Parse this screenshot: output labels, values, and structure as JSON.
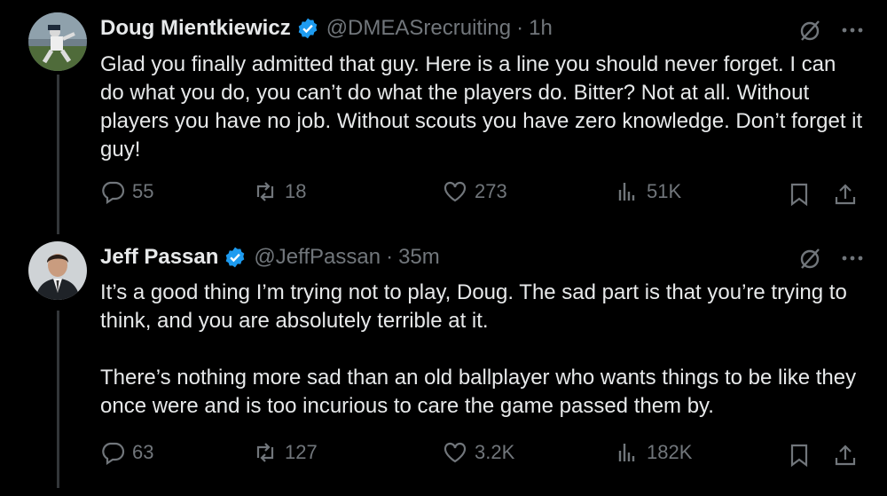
{
  "tweets": [
    {
      "name": "Doug Mientkiewicz",
      "handle": "@DMEASrecruiting",
      "dot": "·",
      "time": "1h",
      "paragraphs": [
        "Glad you finally admitted that guy.  Here is a line you should never forget.  I can do what you do, you can’t do what the players do. Bitter?  Not at all. Without players you have no job. Without scouts you have zero knowledge. Don’t forget it guy!"
      ],
      "replies": "55",
      "reposts": "18",
      "likes": "273",
      "views": "51K"
    },
    {
      "name": "Jeff Passan",
      "handle": "@JeffPassan",
      "dot": "·",
      "time": "35m",
      "paragraphs": [
        "It’s a good thing I’m trying not to play, Doug. The sad part is that you’re trying to think, and you are absolutely terrible at it.",
        "There’s nothing more sad than an old ballplayer who wants things to be like they once were and is too incurious to care the game passed them by."
      ],
      "replies": "63",
      "reposts": "127",
      "likes": "3.2K",
      "views": "182K"
    }
  ],
  "icons": {
    "verified": "verified-badge-icon",
    "grok": "slashed-circle-icon",
    "more": "more-icon",
    "reply": "reply-icon",
    "repost": "repost-icon",
    "like": "heart-icon",
    "views": "views-icon",
    "bookmark": "bookmark-icon",
    "share": "share-icon"
  },
  "colors": {
    "background": "#000000",
    "text": "#e7e9ea",
    "muted": "#71767b",
    "verified": "#1d9bf0"
  }
}
